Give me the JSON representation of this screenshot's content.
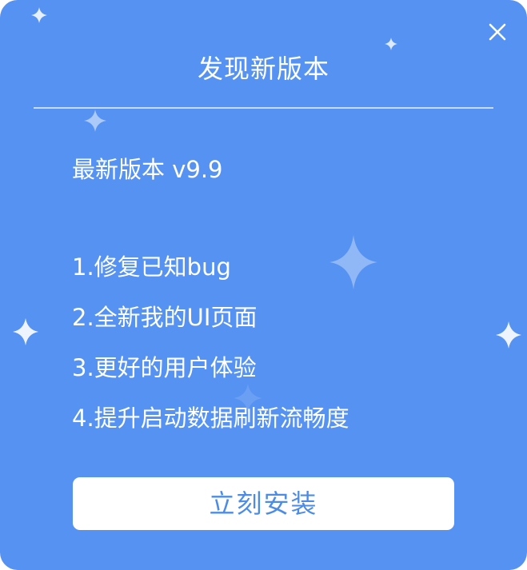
{
  "dialog": {
    "title": "发现新版本",
    "version_label": "最新版本 v9.9",
    "changes": [
      "1.修复已知bug",
      "2.全新我的UI页面",
      "3.更好的用户体验",
      "4.提升启动数据刷新流畅度"
    ],
    "install_label": "立刻安装",
    "close_icon": "close-icon"
  },
  "colors": {
    "background": "#5592f2",
    "button_text": "#4d8ce6",
    "button_background": "#ffffff",
    "divider": "#c6dafb"
  }
}
